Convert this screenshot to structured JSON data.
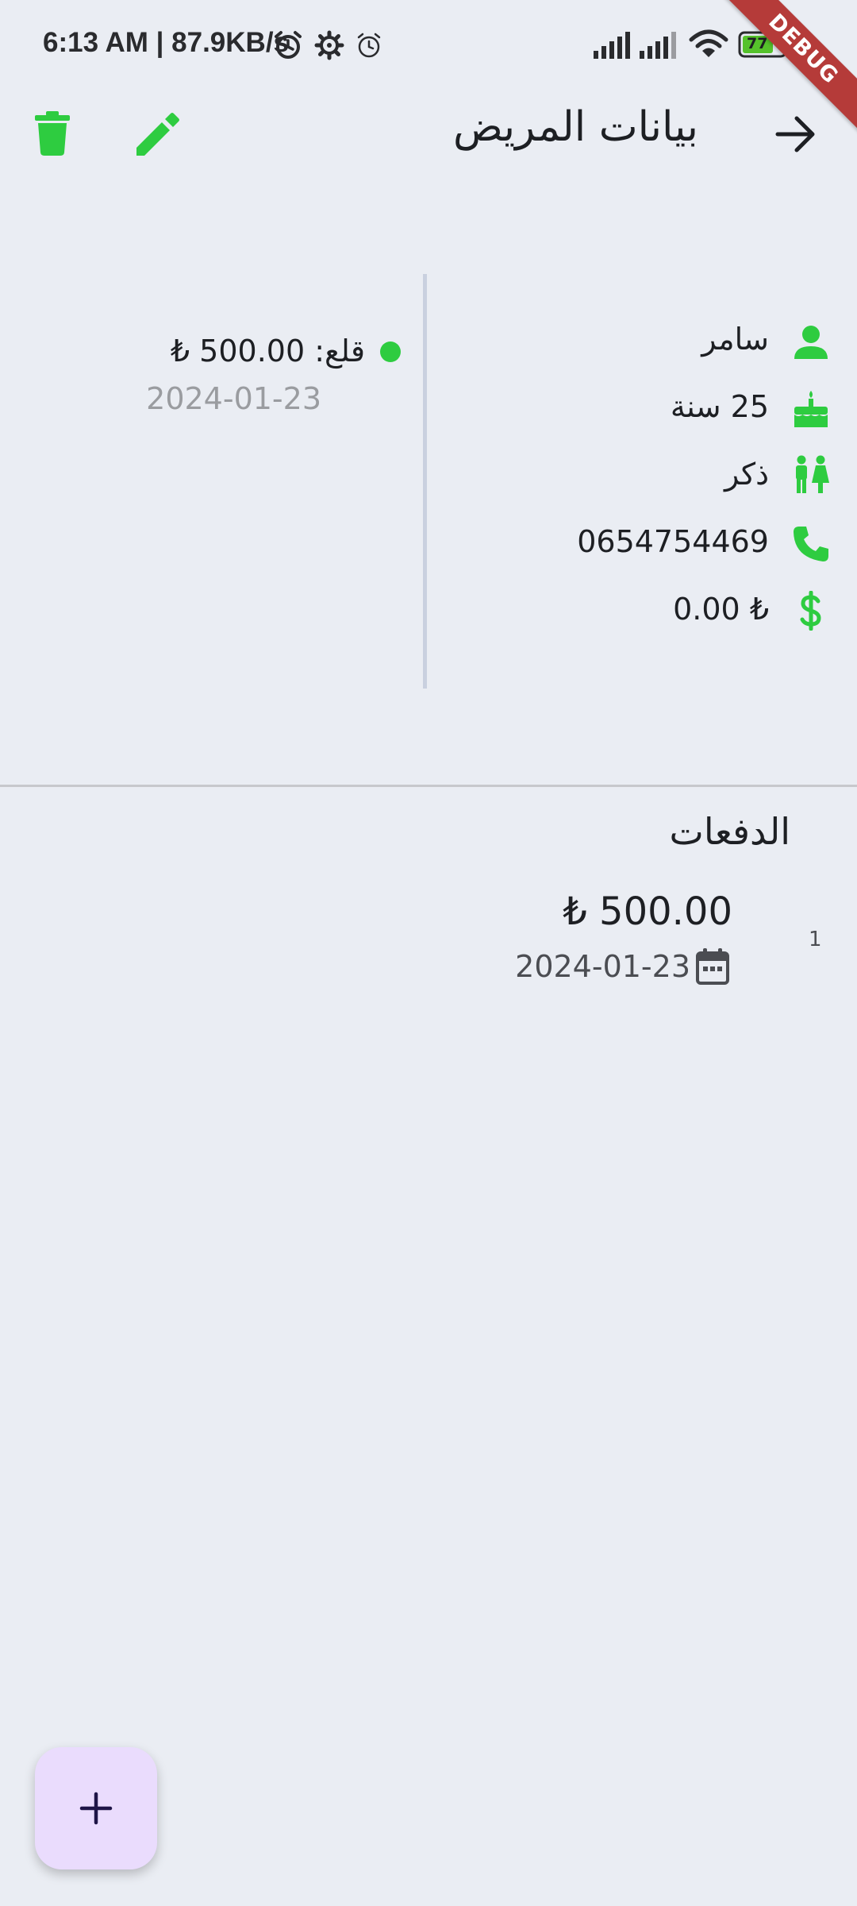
{
  "status_bar": {
    "time_text": "6:13 AM | 87.9KB/s",
    "battery_level": "77"
  },
  "debug_banner": "DEBUG",
  "app_bar": {
    "title": "بيانات المريض",
    "icons": [
      "arrow-right-icon",
      "edit-icon",
      "delete-icon"
    ]
  },
  "patient": {
    "name": "سامر",
    "age": "25 سنة",
    "gender": "ذكر",
    "phone": "0654754469",
    "balance": "₺ 0.00"
  },
  "treatments": [
    {
      "label": "قلع: 500.00 ₺",
      "date": "2024-01-23",
      "status_color": "#2ecc40"
    }
  ],
  "payments": {
    "heading": "الدفعات",
    "items": [
      {
        "index": "1",
        "amount": "₺ 500.00",
        "date": "2024-01-23"
      }
    ]
  },
  "fab": {
    "icon": "plus-icon"
  },
  "colors": {
    "accent": "#2ecc40",
    "background": "#eaedf3",
    "fab_background": "#eadcfd",
    "debug_ribbon": "#b53b39"
  }
}
